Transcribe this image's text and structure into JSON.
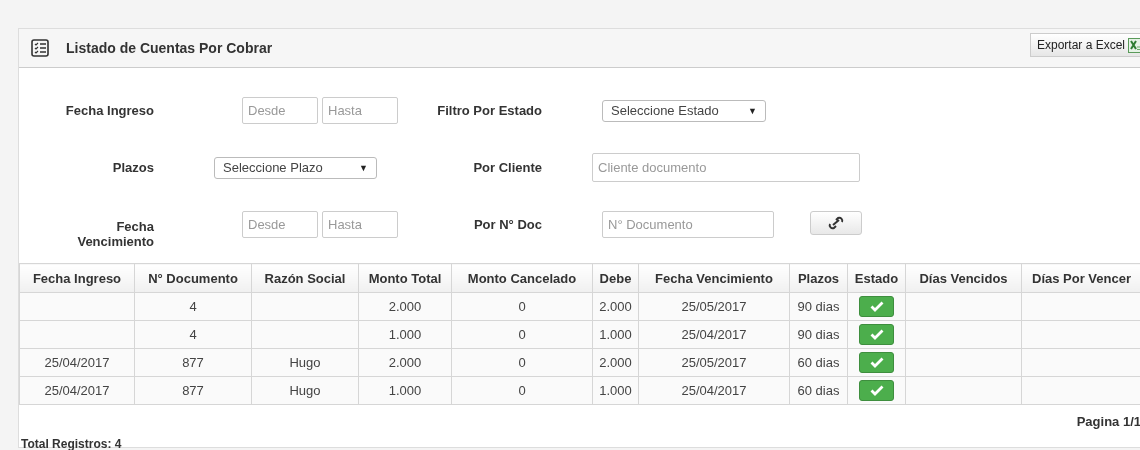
{
  "panel": {
    "title": "Listado de Cuentas Por Cobrar",
    "export_button": "Exportar a Excel"
  },
  "filters": {
    "fecha_ingreso": {
      "label": "Fecha Ingreso",
      "from_placeholder": "Desde",
      "to_placeholder": "Hasta"
    },
    "filtro_estado": {
      "label": "Filtro Por Estado",
      "value": "Seleccione Estado",
      "caret": "▼"
    },
    "plazos": {
      "label": "Plazos",
      "value": "Seleccione Plazo",
      "caret": "▼"
    },
    "cliente": {
      "label": "Por Cliente",
      "placeholder": "Cliente documento"
    },
    "fecha_vencimiento": {
      "label": "Fecha Vencimiento",
      "from_placeholder": "Desde",
      "to_placeholder": "Hasta"
    },
    "documento": {
      "label": "Por N° Doc",
      "placeholder": "N° Documento"
    }
  },
  "table": {
    "columns": [
      "Fecha Ingreso",
      "N° Documento",
      "Razón Social",
      "Monto Total",
      "Monto Cancelado",
      "Debe",
      "Fecha Vencimiento",
      "Plazos",
      "Estado",
      "Días Vencidos",
      "Días Por Vencer"
    ],
    "rows": [
      {
        "fecha_ingreso": "",
        "documento": "4",
        "razon_social": "",
        "monto_total": "2.000",
        "monto_cancelado": "0",
        "debe": "2.000",
        "fecha_vencimiento": "25/05/2017",
        "plazos": "90 dias",
        "paid": true
      },
      {
        "fecha_ingreso": "",
        "documento": "4",
        "razon_social": "",
        "monto_total": "1.000",
        "monto_cancelado": "0",
        "debe": "1.000",
        "fecha_vencimiento": "25/04/2017",
        "plazos": "90 dias",
        "paid": true
      },
      {
        "fecha_ingreso": "25/04/2017",
        "documento": "877",
        "razon_social": "Hugo",
        "monto_total": "2.000",
        "monto_cancelado": "0",
        "debe": "2.000",
        "fecha_vencimiento": "25/05/2017",
        "plazos": "60 dias",
        "paid": true
      },
      {
        "fecha_ingreso": "25/04/2017",
        "documento": "877",
        "razon_social": "Hugo",
        "monto_total": "1.000",
        "monto_cancelado": "0",
        "debe": "1.000",
        "fecha_vencimiento": "25/04/2017",
        "plazos": "60 dias",
        "paid": true
      }
    ]
  },
  "pagination": "Pagina 1/1",
  "total": "Total Registros: 4"
}
